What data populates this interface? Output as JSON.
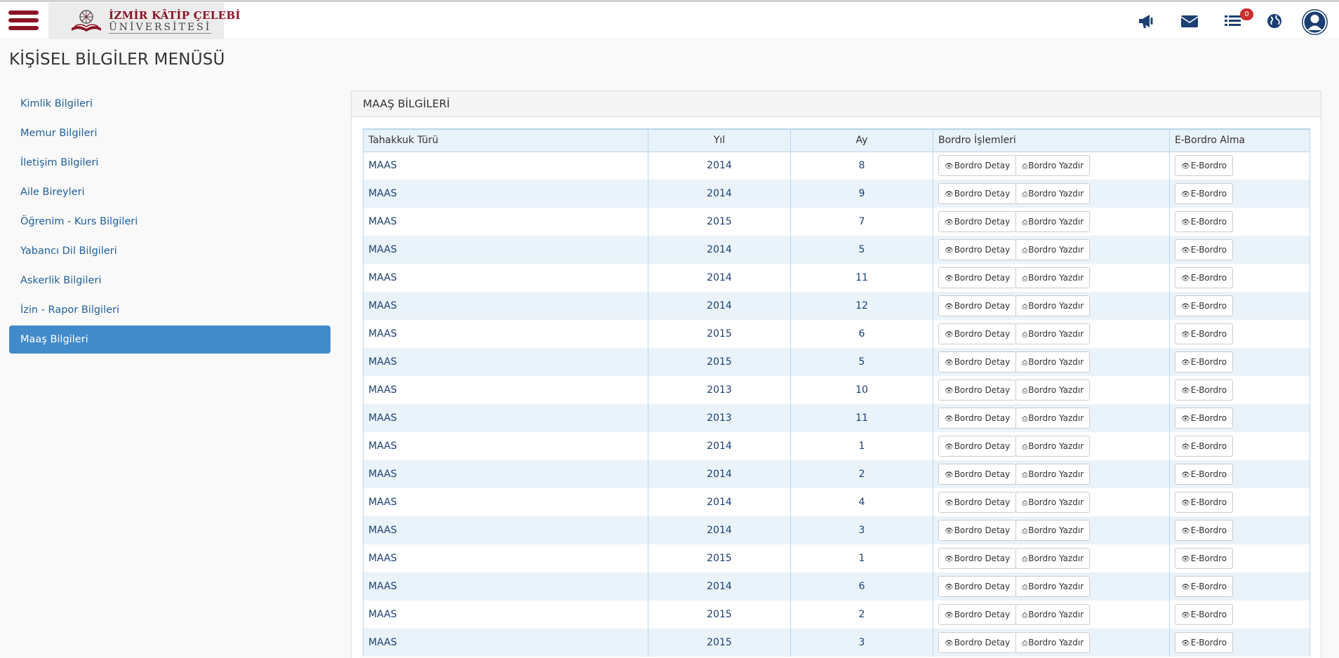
{
  "header": {
    "logo_line1": "İZMİR KÂTİP ÇELEBİ",
    "logo_line2": "ÜNİVERSİTESİ",
    "notification_count": "0",
    "icons": [
      "menu-icon",
      "megaphone-icon",
      "envelope-icon",
      "list-icon",
      "globe-icon",
      "user-icon"
    ]
  },
  "page_title": "KİŞİSEL BİLGİLER MENÜSÜ",
  "sidebar": {
    "items": [
      {
        "label": "Kimlik Bilgileri"
      },
      {
        "label": "Memur Bilgileri"
      },
      {
        "label": "İletişim Bilgileri"
      },
      {
        "label": "Aile Bireyleri"
      },
      {
        "label": "Öğrenim - Kurs Bilgileri"
      },
      {
        "label": "Yabancı Dil Bilgileri"
      },
      {
        "label": "Askerlik Bilgileri"
      },
      {
        "label": "İzin - Rapor Bilgileri"
      },
      {
        "label": "Maaş Bilgileri"
      }
    ],
    "active": "Maaş Bilgileri"
  },
  "panel": {
    "title": "MAAŞ BİLGİLERİ"
  },
  "table": {
    "headers": [
      "Tahakkuk Türü",
      "Yıl",
      "Ay",
      "Bordro İşlemleri",
      "E-Bordro Alma"
    ],
    "button_detail": "Bordro Detay",
    "button_print": "Bordro Yazdır",
    "button_ebordro": "E-Bordro",
    "rows": [
      [
        "MAAS",
        "2014",
        "8"
      ],
      [
        "MAAS",
        "2014",
        "9"
      ],
      [
        "MAAS",
        "2015",
        "7"
      ],
      [
        "MAAS",
        "2014",
        "5"
      ],
      [
        "MAAS",
        "2014",
        "11"
      ],
      [
        "MAAS",
        "2014",
        "12"
      ],
      [
        "MAAS",
        "2015",
        "6"
      ],
      [
        "MAAS",
        "2015",
        "5"
      ],
      [
        "MAAS",
        "2013",
        "10"
      ],
      [
        "MAAS",
        "2013",
        "11"
      ],
      [
        "MAAS",
        "2014",
        "1"
      ],
      [
        "MAAS",
        "2014",
        "2"
      ],
      [
        "MAAS",
        "2014",
        "4"
      ],
      [
        "MAAS",
        "2014",
        "3"
      ],
      [
        "MAAS",
        "2015",
        "1"
      ],
      [
        "MAAS",
        "2014",
        "6"
      ],
      [
        "MAAS",
        "2015",
        "2"
      ],
      [
        "MAAS",
        "2015",
        "3"
      ]
    ]
  },
  "colors": {
    "brand": "#8b1325",
    "active_nav": "#428bca",
    "link": "#1f5f9a",
    "badge": "#c9302c",
    "table_header_bg": "#e8f2f9",
    "table_stripe": "#eaf3fa"
  }
}
